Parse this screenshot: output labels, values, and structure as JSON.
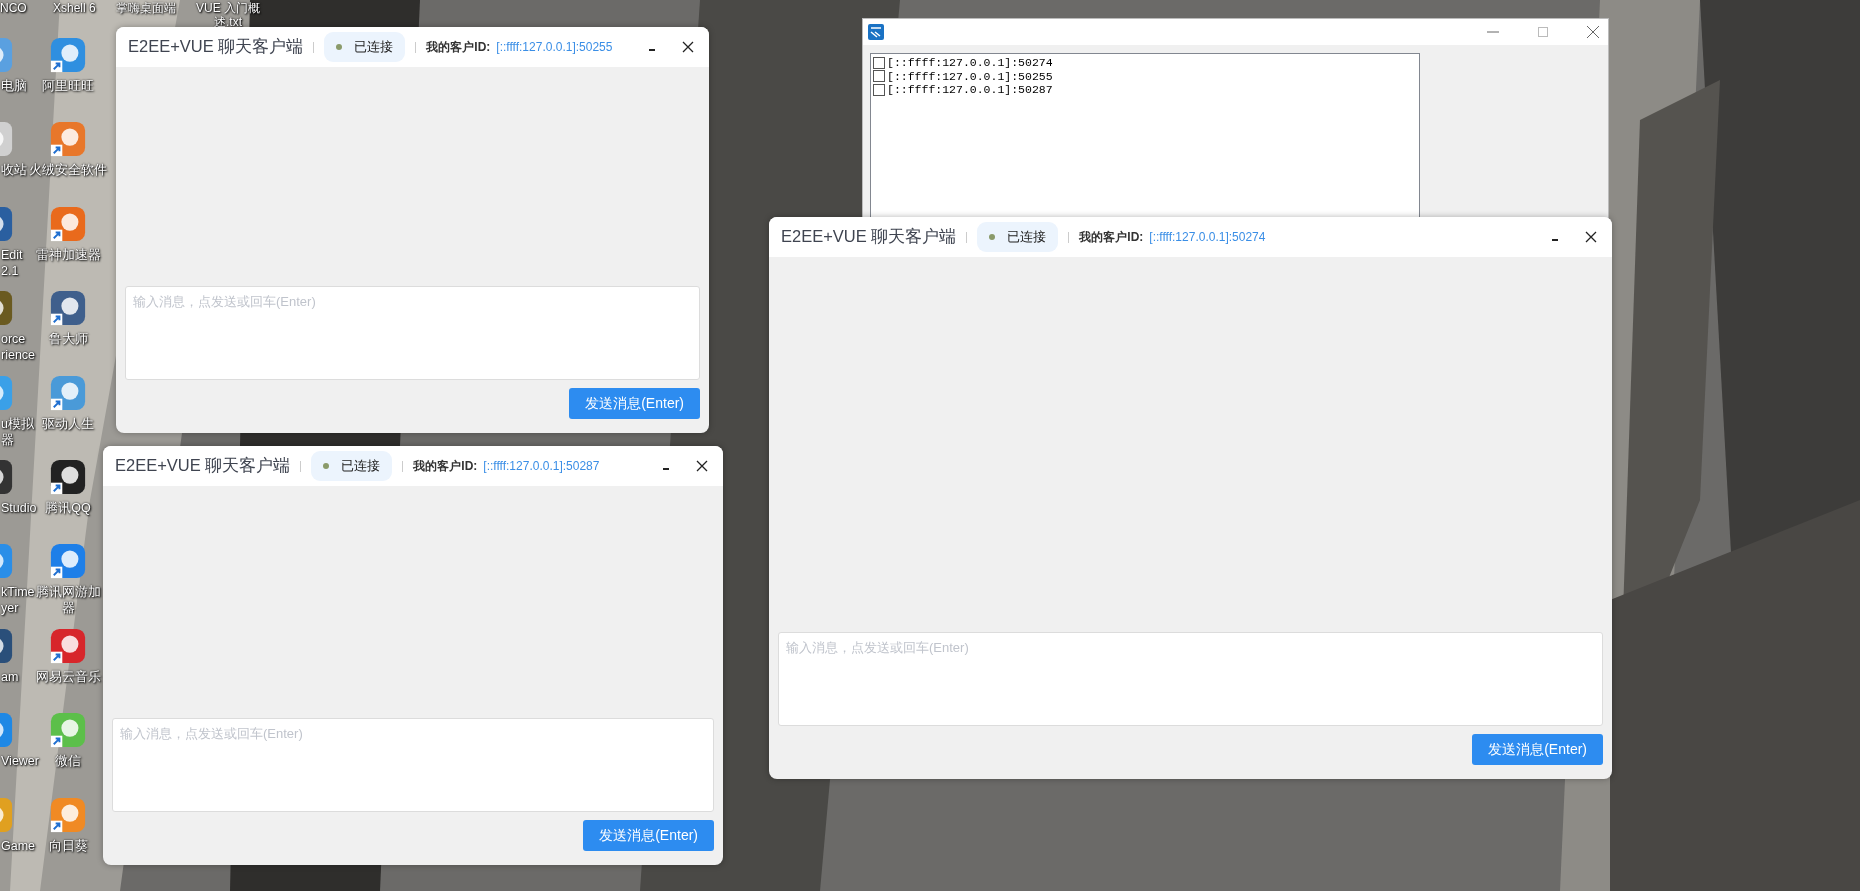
{
  "desktop": {
    "top_labels": [
      {
        "lines": [
          "NCO"
        ]
      },
      {
        "lines": [
          "Xshell 6"
        ]
      },
      {
        "lines": [
          "掌嗨桌面端"
        ]
      },
      {
        "lines": [
          "VUE 入门概",
          "述.txt"
        ]
      }
    ],
    "column_1": [
      {
        "lines": [
          "电脑"
        ]
      },
      {
        "lines": [
          "收站"
        ]
      },
      {
        "lines": [
          "Edit",
          "2.1"
        ]
      },
      {
        "lines": [
          "orce",
          "rience"
        ]
      },
      {
        "lines": [
          "u模拟",
          "器"
        ]
      },
      {
        "lines": [
          "Studio"
        ]
      },
      {
        "lines": [
          "kTime",
          "yer"
        ]
      },
      {
        "lines": [
          "am"
        ]
      },
      {
        "lines": [
          "Viewer"
        ]
      },
      {
        "lines": [
          "Game"
        ]
      }
    ],
    "column_2": [
      {
        "lines": [
          "阿里旺旺"
        ]
      },
      {
        "lines": [
          "火绒安全软件"
        ]
      },
      {
        "lines": [
          "雷神加速器"
        ]
      },
      {
        "lines": [
          "鲁大师"
        ]
      },
      {
        "lines": [
          "驱动人生"
        ]
      },
      {
        "lines": [
          "腾讯QQ"
        ]
      },
      {
        "lines": [
          "腾讯网游加",
          "器"
        ]
      },
      {
        "lines": [
          "网易云音乐"
        ]
      },
      {
        "lines": [
          "微信"
        ]
      },
      {
        "lines": [
          "向日葵"
        ]
      }
    ]
  },
  "list_window": {
    "items": [
      {
        "text": "[::ffff:127.0.0.1]:50274",
        "checked": false
      },
      {
        "text": "[::ffff:127.0.0.1]:50255",
        "checked": false
      },
      {
        "text": "[::ffff:127.0.0.1]:50287",
        "checked": false
      }
    ]
  },
  "chat_windows": [
    {
      "title": "E2EE+VUE 聊天客户端",
      "status": "已连接",
      "connected": true,
      "id_label": "我的客户ID:",
      "client_id": "[::ffff:127.0.0.1]:50255",
      "placeholder": "输入消息，点发送或回车(Enter)",
      "send_button": "发送消息(Enter)"
    },
    {
      "title": "E2EE+VUE 聊天客户端",
      "status": "已连接",
      "connected": true,
      "id_label": "我的客户ID:",
      "client_id": "[::ffff:127.0.0.1]:50287",
      "placeholder": "输入消息，点发送或回车(Enter)",
      "send_button": "发送消息(Enter)"
    },
    {
      "title": "E2EE+VUE 聊天客户端",
      "status": "已连接",
      "connected": true,
      "id_label": "我的客户ID:",
      "client_id": "[::ffff:127.0.0.1]:50274",
      "placeholder": "输入消息，点发送或回车(Enter)",
      "send_button": "发送消息(Enter)"
    }
  ]
}
